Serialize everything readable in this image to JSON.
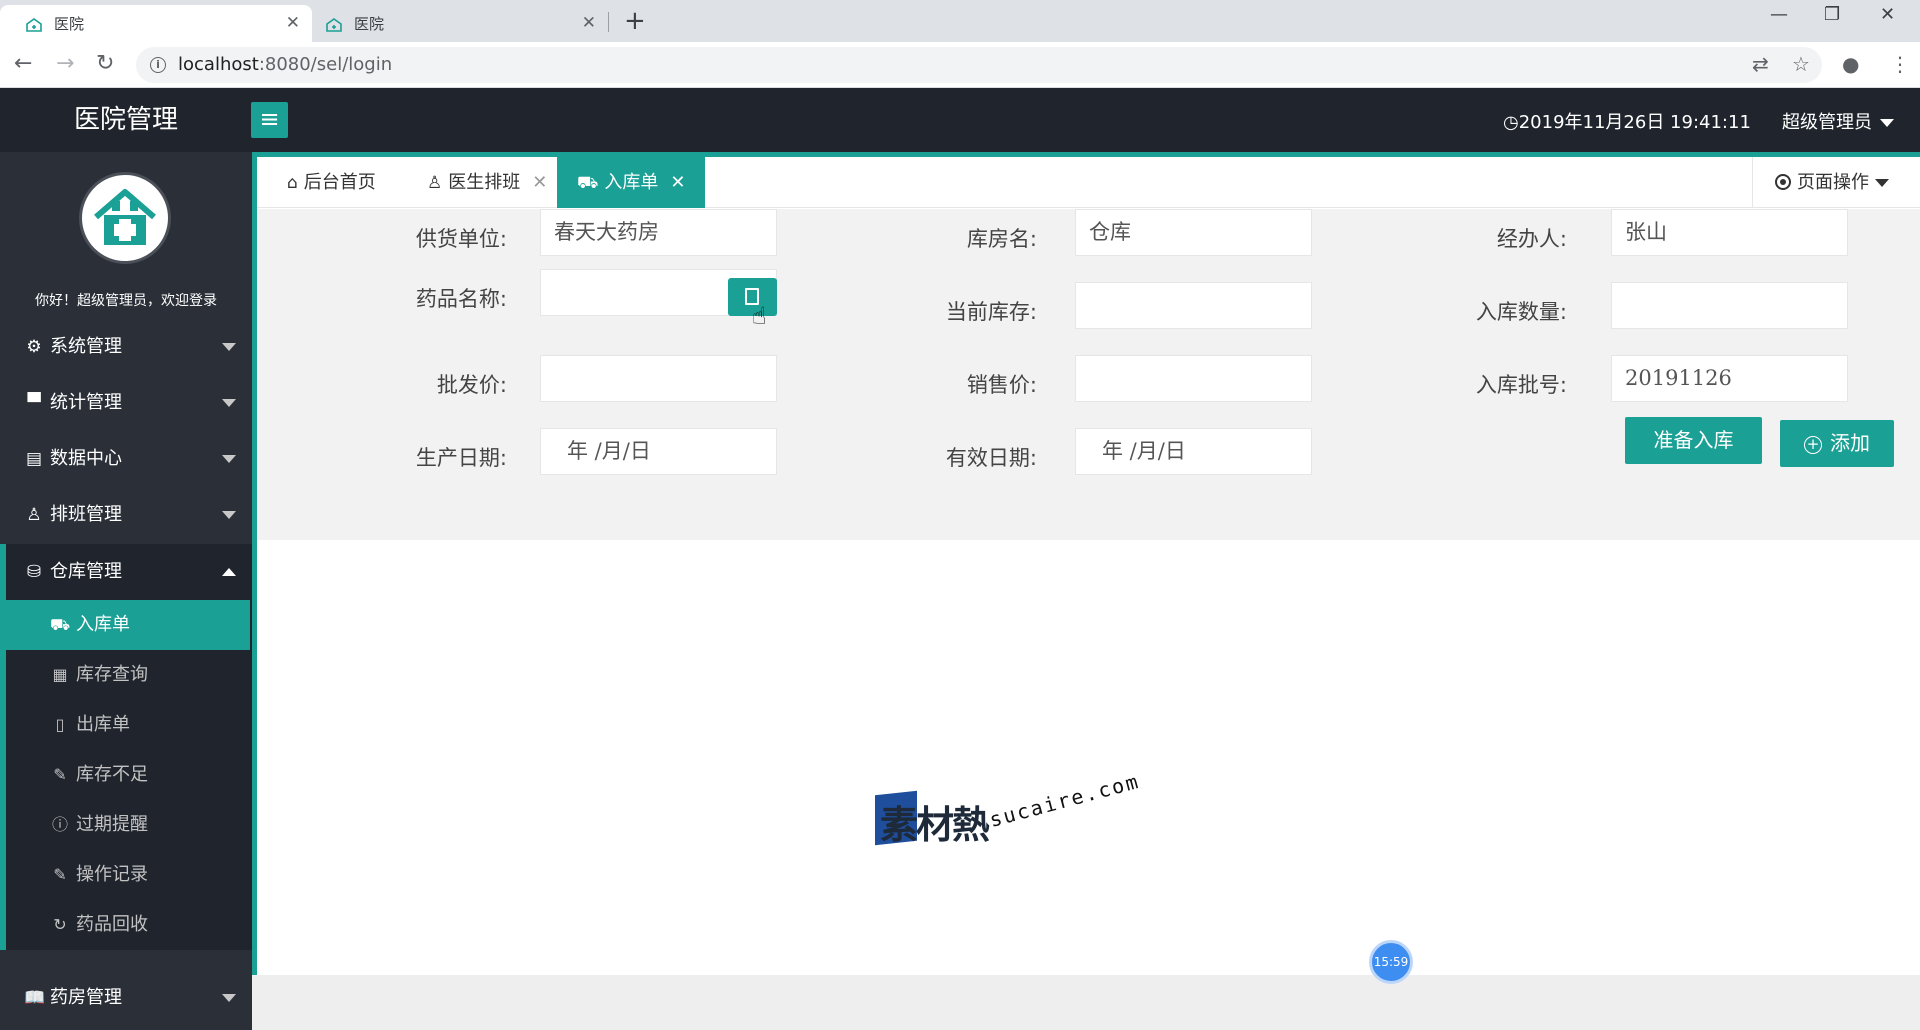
{
  "browser": {
    "tabs": [
      {
        "title": "医院",
        "active": true
      },
      {
        "title": "医院",
        "active": false
      }
    ],
    "url_host": "localhost",
    "url_rest": ":8080/sel/login"
  },
  "header": {
    "brand": "医院管理",
    "datetime": "2019年11月26日 19:41:11",
    "user": "超级管理员"
  },
  "sidebar": {
    "welcome": "你好！超级管理员，欢迎登录",
    "menus": [
      {
        "label": "系统管理",
        "icon": "gear-icon"
      },
      {
        "label": "统计管理",
        "icon": "monitor-icon"
      },
      {
        "label": "数据中心",
        "icon": "document-icon"
      },
      {
        "label": "排班管理",
        "icon": "user-icon"
      },
      {
        "label": "仓库管理",
        "icon": "warehouse-icon",
        "open": true
      },
      {
        "label": "药房管理",
        "icon": "book-icon"
      }
    ],
    "warehouse_items": [
      {
        "label": "入库单",
        "icon": "cart-icon",
        "active": true
      },
      {
        "label": "库存查询",
        "icon": "calendar-icon"
      },
      {
        "label": "出库单",
        "icon": "file-icon"
      },
      {
        "label": "库存不足",
        "icon": "edit-icon"
      },
      {
        "label": "过期提醒",
        "icon": "info-icon"
      },
      {
        "label": "操作记录",
        "icon": "edit-icon"
      },
      {
        "label": "药品回收",
        "icon": "refresh-icon"
      }
    ]
  },
  "page_tabs": [
    {
      "label": "后台首页",
      "icon": "home-icon",
      "closable": false
    },
    {
      "label": "医生排班",
      "icon": "user-icon",
      "closable": true
    },
    {
      "label": "入库单",
      "icon": "cart-icon",
      "closable": true,
      "active": true
    }
  ],
  "page_ops": "页面操作",
  "form": {
    "supplier": {
      "label": "供货单位:",
      "value": "春天大药房"
    },
    "warehouse": {
      "label": "库房名:",
      "value": "仓库"
    },
    "handler": {
      "label": "经办人:",
      "value": "张山"
    },
    "drug_name": {
      "label": "药品名称:",
      "value": ""
    },
    "current_stock": {
      "label": "当前库存:",
      "value": ""
    },
    "in_qty": {
      "label": "入库数量:",
      "value": ""
    },
    "wholesale_price": {
      "label": "批发价:",
      "value": ""
    },
    "sale_price": {
      "label": "销售价:",
      "value": ""
    },
    "batch_no": {
      "label": "入库批号:",
      "value": "20191126"
    },
    "prod_date": {
      "label": "生产日期:",
      "value": "年 /月/日"
    },
    "exp_date": {
      "label": "有效日期:",
      "value": "年 /月/日"
    },
    "prepare_btn": "准备入库",
    "add_btn": "添加"
  },
  "watermark": {
    "brand": "素材熱",
    "url": "sucaire.com"
  },
  "timer": "15:59",
  "colors": {
    "accent": "#1aa094",
    "header_bg": "#1f242d",
    "sidebar_bg": "#2a2f38"
  }
}
